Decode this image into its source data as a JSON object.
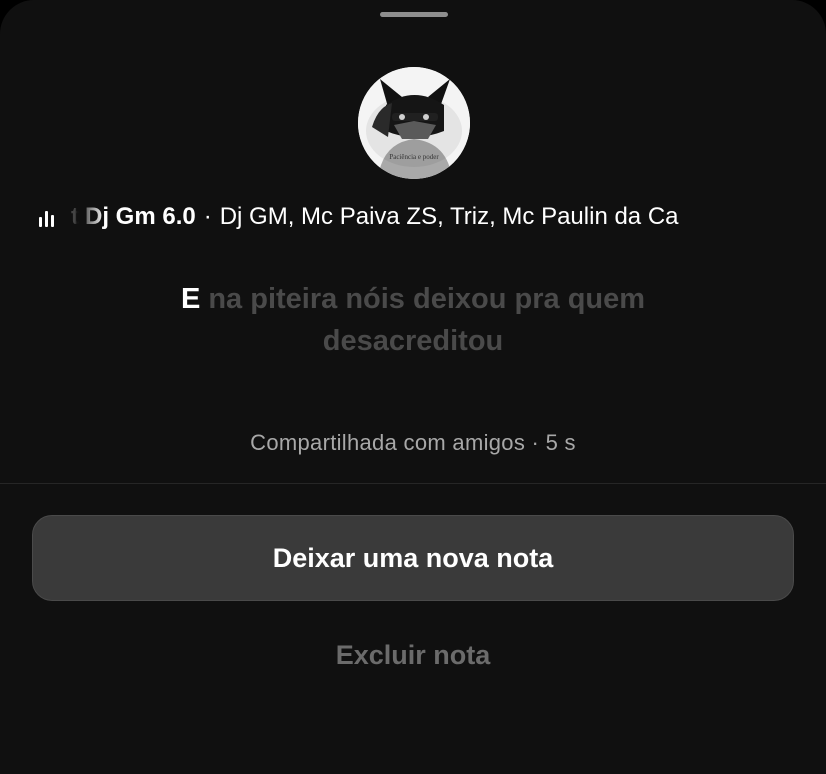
{
  "note": {
    "music": {
      "partial_prefix": "t",
      "title": "Dj Gm 6.0",
      "separator": "·",
      "artists": "Dj GM, Mc Paiva ZS, Triz, Mc Paulin da Ca",
      "icon": "equalizer-icon"
    },
    "lyrics": {
      "active": "E",
      "rest": " na piteira nóis deixou pra quem desacreditou"
    },
    "avatar": {
      "caption": "Paciência e poder"
    },
    "shared_text": "Compartilhada com amigos · 5 s"
  },
  "actions": {
    "new_note_label": "Deixar uma nova nota",
    "delete_label": "Excluir nota"
  },
  "colors": {
    "sheet_background": "#101010",
    "button_background": "#3a3a3a",
    "muted_text": "#a8a8a8",
    "disabled_text": "#6b6b6b"
  }
}
